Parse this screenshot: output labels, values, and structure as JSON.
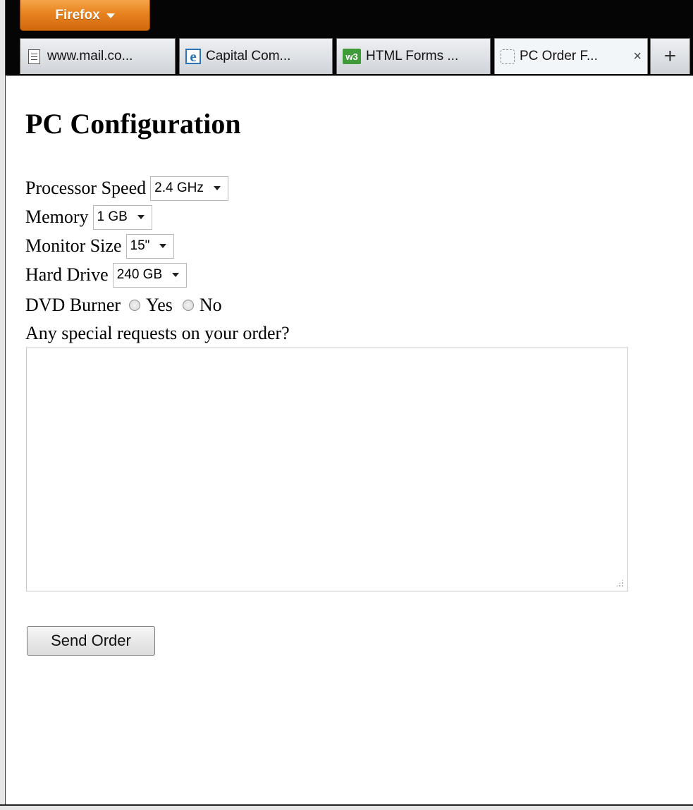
{
  "browser": {
    "menu_label": "Firefox",
    "tabs": [
      {
        "title": "www.mail.co...",
        "icon": "page-icon"
      },
      {
        "title": "Capital Com...",
        "icon": "capital-e-icon"
      },
      {
        "title": "HTML Forms ...",
        "icon": "w3schools-icon",
        "icon_text": "w3"
      },
      {
        "title": "PC Order F...",
        "icon": "blank-page-icon",
        "active": true,
        "close_symbol": "×"
      }
    ],
    "new_tab_symbol": "+"
  },
  "page": {
    "heading": "PC Configuration",
    "processor": {
      "label": "Processor Speed",
      "value": "2.4 GHz"
    },
    "memory": {
      "label": "Memory",
      "value": "1 GB"
    },
    "monitor": {
      "label": "Monitor Size",
      "value": "15\""
    },
    "hard_drive": {
      "label": "Hard Drive",
      "value": "240 GB"
    },
    "dvd": {
      "label": "DVD Burner",
      "yes": "Yes",
      "no": "No"
    },
    "requests_label": "Any special requests on your order?",
    "requests_value": "",
    "submit_label": "Send Order"
  },
  "colors": {
    "firefox_button": "#e8821f",
    "titlebar": "#050505",
    "page_bg": "#ffffff"
  }
}
